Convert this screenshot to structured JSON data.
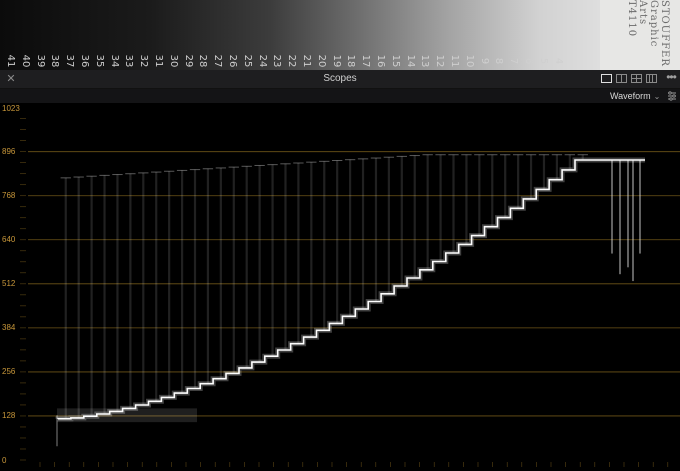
{
  "wedge": {
    "steps": [
      "41",
      "40",
      "39",
      "38",
      "37",
      "36",
      "35",
      "34",
      "33",
      "32",
      "31",
      "30",
      "29",
      "28",
      "27",
      "26",
      "25",
      "24",
      "23",
      "22",
      "21",
      "20",
      "19",
      "18",
      "17",
      "16",
      "15",
      "14",
      "13",
      "12",
      "11",
      "10",
      "9",
      "8",
      "7",
      "6",
      "5",
      "4"
    ],
    "brand_line1": "STOUFFER",
    "brand_line2": "Graphic Arts",
    "brand_line3": "T4110"
  },
  "panel": {
    "title": "Scopes",
    "close_icon": "close-icon",
    "layout_icons": [
      "single-layout-icon",
      "dual-layout-icon",
      "quad-split-icon",
      "grid-layout-icon"
    ],
    "more_icon": "more-icon"
  },
  "toolbar": {
    "scope_type": "Waveform",
    "settings_icon": "settings-icon"
  },
  "scope": {
    "y_ticks": [
      "1023",
      "896",
      "768",
      "640",
      "512",
      "384",
      "256",
      "128",
      "0"
    ],
    "grid_color": "#6e5518",
    "label_color": "#c8973a",
    "trace_color": "#ffffff"
  }
}
